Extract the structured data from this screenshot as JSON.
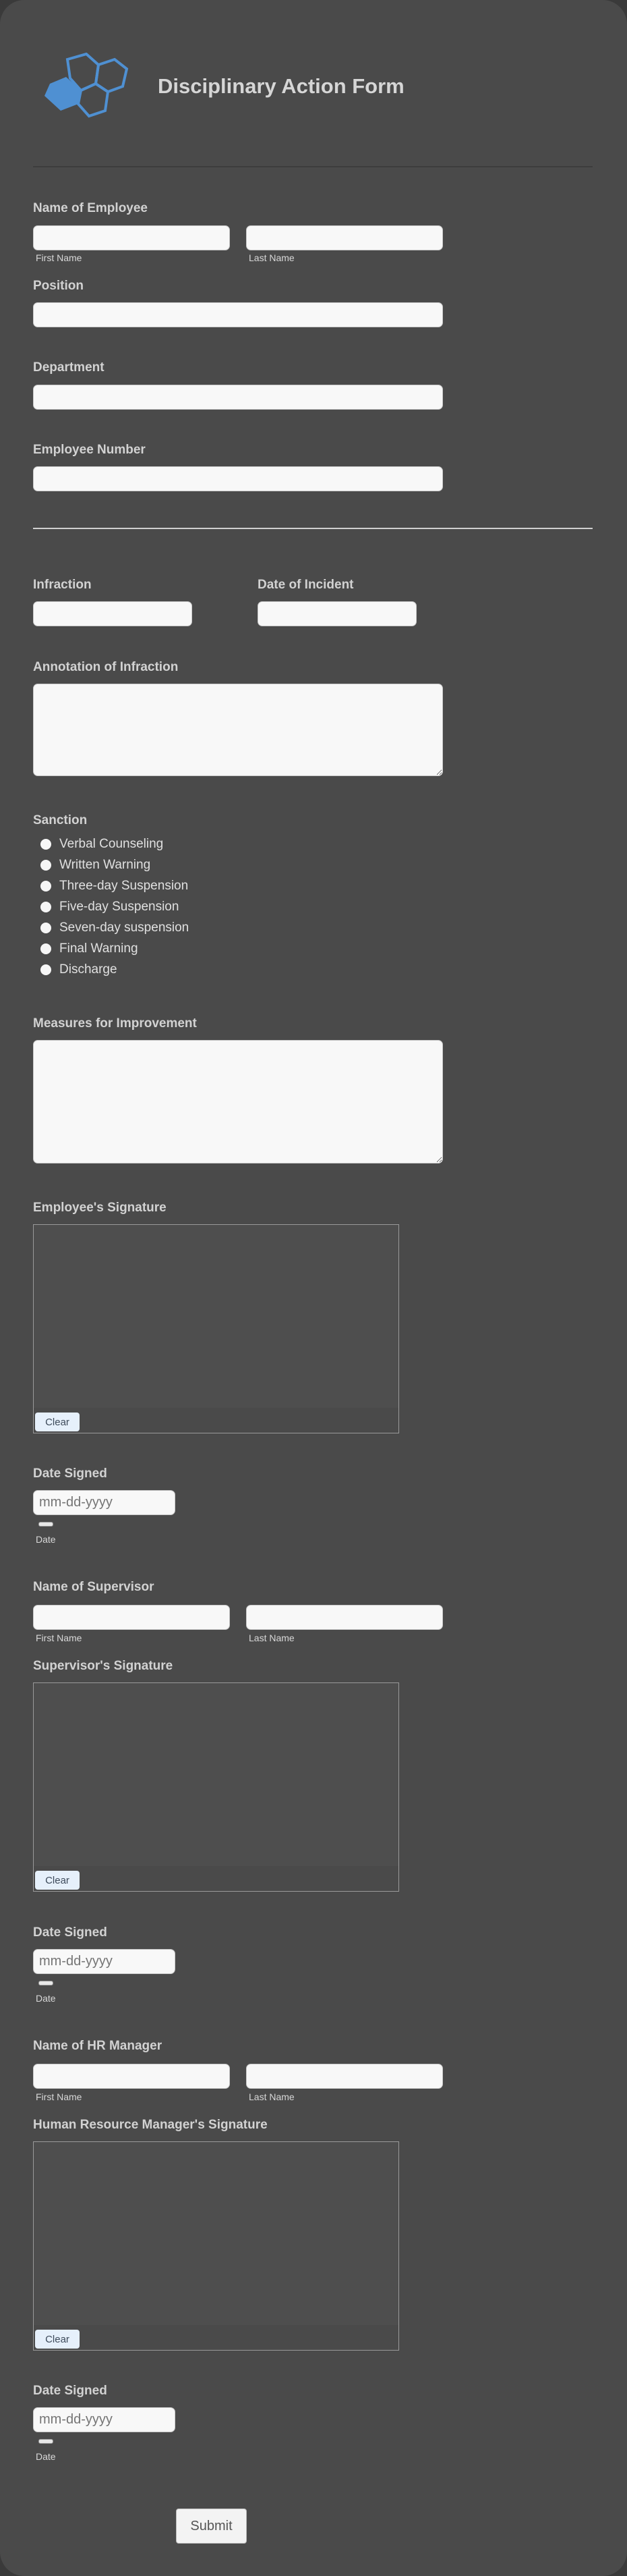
{
  "header": {
    "title": "Disciplinary Action Form",
    "logo": "hexagon-logo",
    "accent": "#4f90d2"
  },
  "employee_name": {
    "label": "Name of Employee",
    "first": "First Name",
    "last": "Last Name"
  },
  "position": {
    "label": "Position"
  },
  "department": {
    "label": "Department"
  },
  "employee_number": {
    "label": "Employee Number"
  },
  "infraction": {
    "label": "Infraction"
  },
  "date_of_incident": {
    "label": "Date of Incident"
  },
  "annotation": {
    "label": "Annotation of Infraction"
  },
  "sanction": {
    "label": "Sanction",
    "options": [
      "Verbal Counseling",
      "Written Warning",
      "Three-day Suspension",
      "Five-day Suspension",
      "Seven-day suspension",
      "Final Warning",
      "Discharge"
    ]
  },
  "measures": {
    "label": "Measures for Improvement"
  },
  "employee_signature": {
    "label": "Employee's Signature",
    "clear": "Clear"
  },
  "date_signed_1": {
    "label": "Date Signed",
    "placeholder": "mm-dd-yyyy",
    "sublabel": "Date"
  },
  "supervisor_name": {
    "label": "Name of Supervisor",
    "first": "First Name",
    "last": "Last Name"
  },
  "supervisor_signature": {
    "label": "Supervisor's Signature",
    "clear": "Clear"
  },
  "date_signed_2": {
    "label": "Date Signed",
    "placeholder": "mm-dd-yyyy",
    "sublabel": "Date"
  },
  "hr_name": {
    "label": "Name of HR Manager",
    "first": "First Name",
    "last": "Last Name"
  },
  "hr_signature": {
    "label": "Human Resource Manager's Signature",
    "clear": "Clear"
  },
  "date_signed_3": {
    "label": "Date Signed",
    "placeholder": "mm-dd-yyyy",
    "sublabel": "Date"
  },
  "submit": "Submit"
}
